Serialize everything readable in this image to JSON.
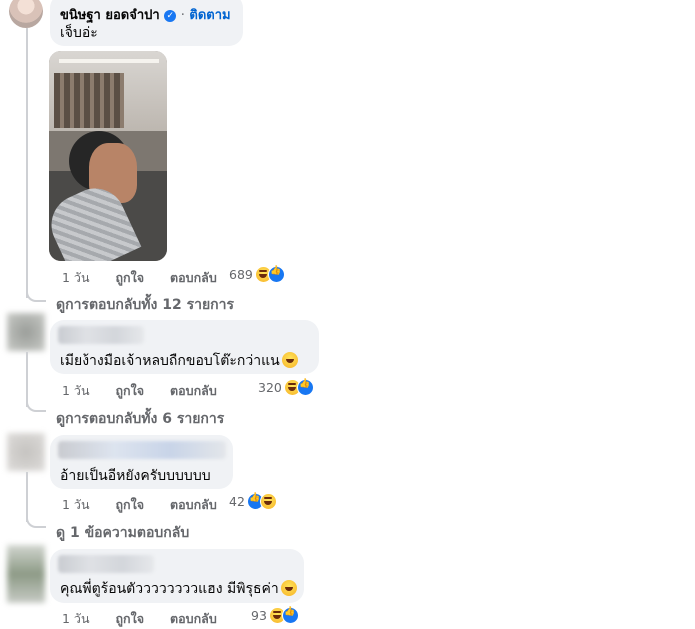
{
  "top_comment": {
    "author": "ขนิษฐา ยอดจำปา",
    "separator": "·",
    "follow_label": "ติดตาม",
    "text": "เจ็บอ่ะ",
    "time": "1 วัน",
    "like_label": "ถูกใจ",
    "reply_label": "ตอบกลับ",
    "reaction_count": "689",
    "view_replies": "ดูการตอบกลับทั้ง 12 รายการ"
  },
  "comments": [
    {
      "text": "เมียง้างมือเจ้าหลบถืกขอบโต๊ะกว่าแน",
      "time": "1 วัน",
      "like_label": "ถูกใจ",
      "reply_label": "ตอบกลับ",
      "reaction_count": "320",
      "view_replies": "ดูการตอบกลับทั้ง 6 รายการ"
    },
    {
      "text": "อ้ายเป็นอีหยังครับบบบบบ",
      "time": "1 วัน",
      "like_label": "ถูกใจ",
      "reply_label": "ตอบกลับ",
      "reaction_count": "42",
      "view_replies": "ดู 1 ข้อความตอบกลับ"
    },
    {
      "text": "คุณพี่ตูร้อนตัววววววววแฮง มีพิรุธค่า",
      "time": "1 วัน",
      "like_label": "ถูกใจ",
      "reply_label": "ตอบกลับ",
      "reaction_count": "93"
    }
  ],
  "colors": {
    "bubble": "#f0f2f5",
    "link_blue": "#0064d1",
    "muted": "#65676b",
    "like_blue": "#1877f2"
  }
}
